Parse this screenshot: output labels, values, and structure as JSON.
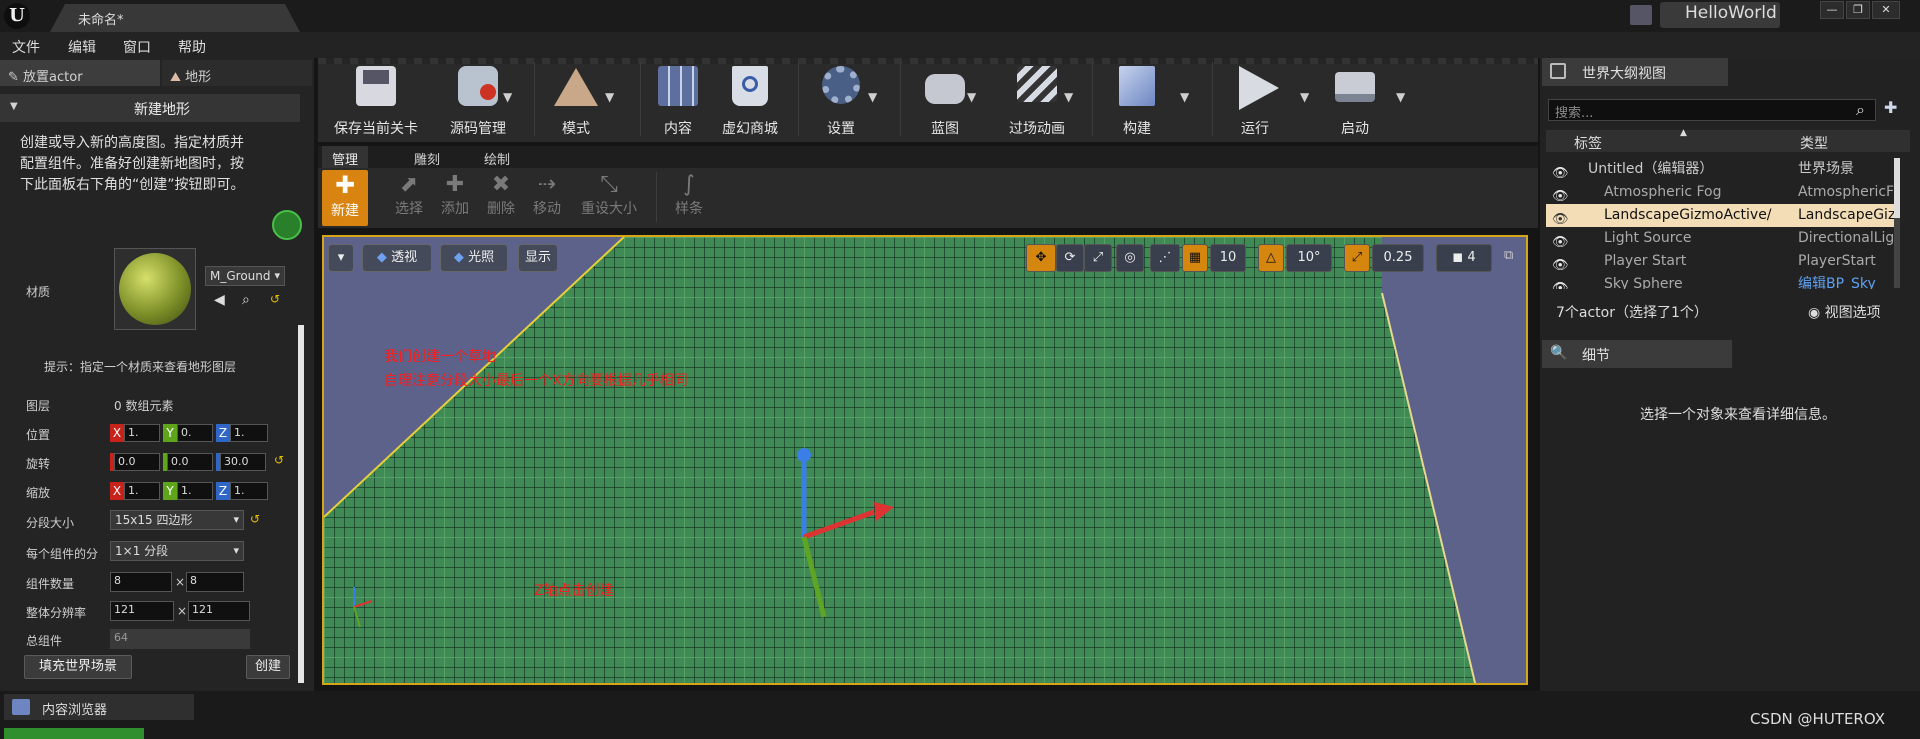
{
  "window": {
    "doc_tab": "未命名*",
    "project": "HelloWorld",
    "buttons": [
      "—",
      "❐",
      "✕"
    ]
  },
  "menubar": [
    "文件",
    "编辑",
    "窗口",
    "帮助"
  ],
  "left_panel": {
    "tabs": [
      "放置actor",
      "地形"
    ],
    "section": "新建地形",
    "description": [
      "创建或导入新的高度图。指定材质并",
      "配置组件。准备好创建新地图时，按",
      "下此面板右下角的“创建”按钮即可。"
    ],
    "material_label": "材质",
    "material_value": "M_Ground",
    "hint": "提示：指定一个材质来查看地形图层",
    "layers_label": "图层",
    "layers_value": "0 数组元素",
    "location": {
      "label": "位置",
      "x": "1.",
      "y": "0.",
      "z": "1."
    },
    "rotation": {
      "label": "旋转",
      "x": "0.0",
      "y": "0.0",
      "z": "30.0"
    },
    "scale": {
      "label": "缩放",
      "x": "1.",
      "y": "1.",
      "z": "1."
    },
    "section_size": {
      "label": "分段大小",
      "value": "15x15 四边形"
    },
    "per_component": {
      "label": "每个组件的分",
      "value": "1×1 分段"
    },
    "component_count": {
      "label": "组件数量",
      "x": "8",
      "y": "8",
      "times": "×"
    },
    "resolution": {
      "label": "整体分辨率",
      "x": "121",
      "y": "121",
      "times": "×"
    },
    "total_components": {
      "label": "总组件",
      "value": "64"
    },
    "fill_button": "填充世界场景",
    "create_button": "创建"
  },
  "toolbar": [
    {
      "label": "保存当前关卡",
      "icon": "save-icon"
    },
    {
      "label": "源码管理",
      "icon": "source-control-icon"
    },
    {
      "label": "模式",
      "icon": "modes-icon"
    },
    {
      "label": "内容",
      "icon": "content-icon"
    },
    {
      "label": "虚幻商城",
      "icon": "marketplace-icon"
    },
    {
      "label": "设置",
      "icon": "settings-icon"
    },
    {
      "label": "蓝图",
      "icon": "blueprint-icon"
    },
    {
      "label": "过场动画",
      "icon": "cinematics-icon"
    },
    {
      "label": "构建",
      "icon": "build-icon"
    },
    {
      "label": "运行",
      "icon": "play-icon"
    },
    {
      "label": "启动",
      "icon": "launch-icon"
    }
  ],
  "mode_tabs": [
    "管理",
    "雕刻",
    "绘制"
  ],
  "tools": [
    {
      "label": "新建",
      "icon": "new-icon"
    },
    {
      "label": "选择",
      "icon": "select-icon"
    },
    {
      "label": "添加",
      "icon": "add-icon"
    },
    {
      "label": "删除",
      "icon": "delete-icon"
    },
    {
      "label": "移动",
      "icon": "move-icon"
    },
    {
      "label": "重设大小",
      "icon": "resize-icon"
    },
    {
      "label": "样条",
      "icon": "spline-icon"
    }
  ],
  "viewport": {
    "perspective": "透视",
    "lighting": "光照",
    "show": "显示",
    "grid_snap": "10",
    "rotation_snap": "10°",
    "scale_snap": "0.25",
    "camera_speed": "4",
    "annotation_1": "我们创建一个草地",
    "annotation_2": "自理注意分段大小最后一个X方向要根据几乎相同",
    "annotation_3": "Z轴点击创建"
  },
  "outliner": {
    "title": "世界大纲视图",
    "search_placeholder": "搜索...",
    "col_label": "标签",
    "col_type": "类型",
    "rows": [
      {
        "name": "Untitled（编辑器）",
        "type": "世界场景"
      },
      {
        "name": "Atmospheric Fog",
        "type": "AtmosphericF"
      },
      {
        "name": "LandscapeGizmoActive/",
        "type": "LandscapeGiz"
      },
      {
        "name": "Light Source",
        "type": "DirectionalLig"
      },
      {
        "name": "Player Start",
        "type": "PlayerStart"
      },
      {
        "name": "Sky Sphere",
        "type": "编辑BP_Sky"
      }
    ],
    "status": "7个actor（选择了1个）",
    "view_options": "视图选项"
  },
  "details": {
    "title": "细节",
    "empty_text": "选择一个对象来查看详细信息。"
  },
  "bottom": {
    "content_browser": "内容浏览器",
    "watermark": "CSDN @HUTEROX"
  }
}
